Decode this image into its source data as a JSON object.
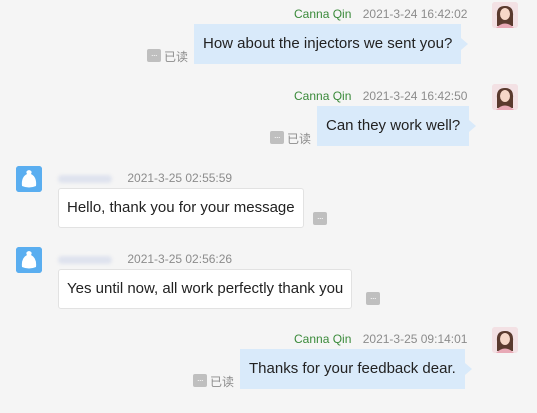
{
  "messages": [
    {
      "sender": "Canna Qin",
      "time": "2021-3-24 16:42:02",
      "text": "How about the injectors we sent you?",
      "status": "已读"
    },
    {
      "sender": "Canna Qin",
      "time": "2021-3-24 16:42:50",
      "text": "Can they work well?",
      "status": "已读"
    },
    {
      "sender": "",
      "time": "2021-3-25 02:55:59",
      "text": "Hello, thank you for your message"
    },
    {
      "sender": "",
      "time": "2021-3-25 02:56:26",
      "text": "Yes until now, all work perfectly thank you"
    },
    {
      "sender": "Canna Qin",
      "time": "2021-3-25 09:14:01",
      "text": "Thanks for your feedback dear.",
      "status": "已读"
    }
  ],
  "icons": {
    "more": "more-options-icon",
    "self_avatar": "user-avatar-female",
    "peer_avatar": "user-avatar-default"
  },
  "colors": {
    "outgoing_bubble": "#d9eafa",
    "incoming_bubble": "#ffffff",
    "sender_name": "#3a8a3a",
    "background": "#f5f5f5"
  }
}
